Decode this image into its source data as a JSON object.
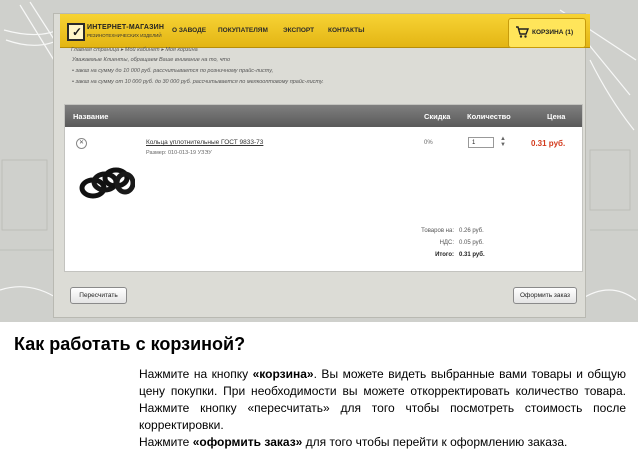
{
  "site": {
    "logo_title": "ИНТЕРНЕТ-МАГАЗИН",
    "logo_subtitle": "РЕЗИНОТЕХНИЧЕСКИХ ИЗДЕЛИЙ",
    "nav": [
      "О ЗАВОДЕ",
      "ПОКУПАТЕЛЯМ",
      "ЭКСПОРТ",
      "КОНТАКТЫ"
    ],
    "cart_label": "КОРЗИНА (1)"
  },
  "breadcrumb": "Главная страница ▸ Мой кабинет ▸ Моя корзина",
  "notices": [
    "Уважаемые Клиенты, обращаем Ваше внимание на то, что",
    "• заказ на сумму до 10 000 руб. рассчитывается по розничному прайс-листу,",
    "• заказ на сумму от 10 000 руб. до 30 000 руб. рассчитывается по мелкооптовому прайс-листу."
  ],
  "table": {
    "headers": {
      "name": "Название",
      "discount": "Скидка",
      "quantity": "Количество",
      "price": "Цена"
    },
    "rows": [
      {
        "name": "Кольца уплотнительные ГОСТ 9833-73",
        "size": "Размер: 010-013-19 УЗЭУ",
        "discount": "0%",
        "quantity": "1",
        "price": "0.31 руб."
      }
    ]
  },
  "totals": {
    "goods_label": "Товаров на:",
    "goods_value": "0.26 руб.",
    "vat_label": "НДС:",
    "vat_value": "0.05 руб.",
    "total_label": "Итого:",
    "total_value": "0.31 руб."
  },
  "buttons": {
    "recalc": "Пересчитать",
    "checkout": "Оформить заказ"
  },
  "help": {
    "title": "Как работать с корзиной?",
    "p1_a": "Нажмите на кнопку ",
    "p1_b": "«корзина»",
    "p1_c": ". Вы можете видеть выбранные вами товары и общую цену покупки. При необходимости вы можете откорректировать количество товара. Нажмите кнопку «пересчитать» для того чтобы посмотреть стоимость после корректировки.",
    "p2_a": "Нажмите ",
    "p2_b": "«оформить заказ»",
    "p2_c": " для того чтобы перейти к оформлению заказа."
  }
}
